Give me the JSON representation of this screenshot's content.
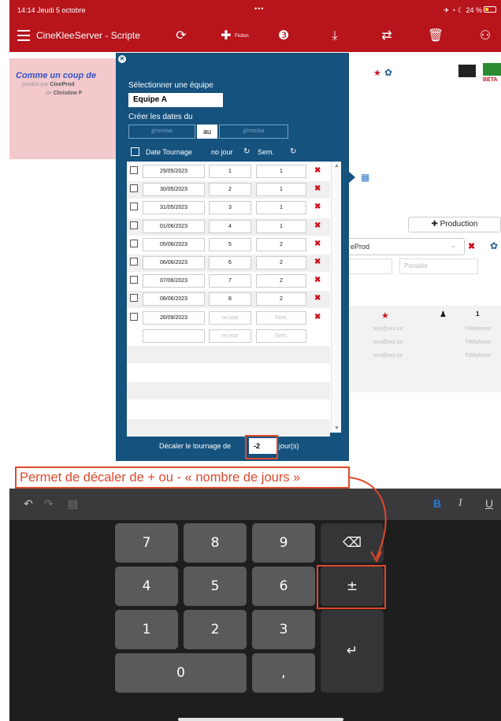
{
  "status": {
    "time": "14:14  Jeudi 5 octobre",
    "dots": "•••",
    "right": "✈ ◔ ☾ 24 %"
  },
  "app": {
    "title": "CineKleeServer - Scripte",
    "fiction_label": "Fiction"
  },
  "project": {
    "title": "Comme un coup de",
    "produced_by_prefix": "produit par",
    "producer": "CineProd",
    "de_prefix": "de",
    "author": "Christine F"
  },
  "beta_label": "BETA",
  "production_button": "Production",
  "production_select": "eProd",
  "portable_placeholder": "Portable",
  "contacts": {
    "emails": [
      "xxx@xxx.xx",
      "xxx@xxx.xx",
      "xxx@xxx.xx"
    ],
    "phones": [
      "Téléphone",
      "Téléphone",
      "Téléphone"
    ],
    "count": "1"
  },
  "modal": {
    "select_team_label": "Sélectionner une équipe",
    "team_value": "Equipe A",
    "create_dates_label": "Créer les dates du",
    "date_from_placeholder": "jj/mm/aa",
    "date_to_placeholder": "jj/mm/aa",
    "au_label": "au",
    "headers": {
      "date": "Date Tournage",
      "day": "no jour",
      "week": "Sem."
    },
    "rows": [
      {
        "date": "29/05/2023",
        "day": "1",
        "week": "1"
      },
      {
        "date": "30/05/2023",
        "day": "2",
        "week": "1"
      },
      {
        "date": "31/05/2023",
        "day": "3",
        "week": "1"
      },
      {
        "date": "01/06/2023",
        "day": "4",
        "week": "1"
      },
      {
        "date": "05/06/2023",
        "day": "5",
        "week": "2"
      },
      {
        "date": "06/06/2023",
        "day": "6",
        "week": "2"
      },
      {
        "date": "07/06/2023",
        "day": "7",
        "week": "2"
      },
      {
        "date": "08/06/2023",
        "day": "8",
        "week": "2"
      },
      {
        "date": "26/09/2023",
        "day": "",
        "week": ""
      }
    ],
    "day_placeholder": "no jour",
    "week_placeholder": "Sem.",
    "shift_label": "Décaler le tournage de",
    "shift_value": "-2",
    "shift_unit": "jour(s)"
  },
  "annotation": "Permet de décaler de + ou - « nombre de jours »",
  "keypad": {
    "keys": [
      "7",
      "8",
      "9",
      "4",
      "5",
      "6",
      "1",
      "2",
      "3",
      "0",
      ","
    ],
    "backspace_icon": "⌫",
    "plusminus": "±",
    "return_icon": "↵"
  },
  "accent_colors": {
    "appbar": "#b7141c",
    "modal": "#15527e",
    "annotation": "#e0482b"
  }
}
